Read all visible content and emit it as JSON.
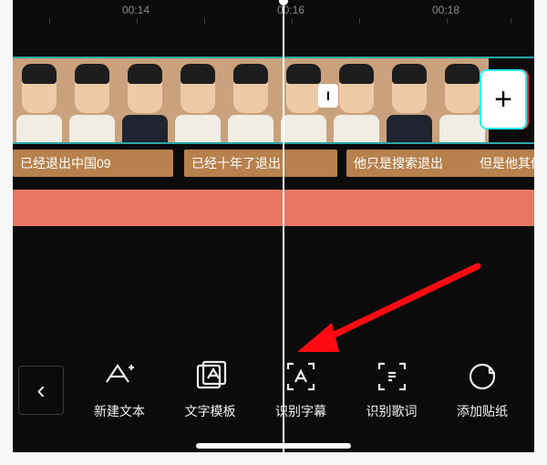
{
  "ruler": {
    "t0": "00:14",
    "t1": "00:16",
    "t2": "00:18"
  },
  "marker": {
    "label": "I"
  },
  "add": {
    "label": "+"
  },
  "subs": {
    "s0": "已经退出中国09",
    "s1": "已经十年了退出",
    "s2": "他只是搜索退出",
    "s3": "但是他其他"
  },
  "back": {
    "glyph": "‹"
  },
  "tools": {
    "new_text": "新建文本",
    "tmpl": "文字模板",
    "recog_sub": "识别字幕",
    "recog_lyric": "识别歌词",
    "sticker": "添加贴纸"
  }
}
